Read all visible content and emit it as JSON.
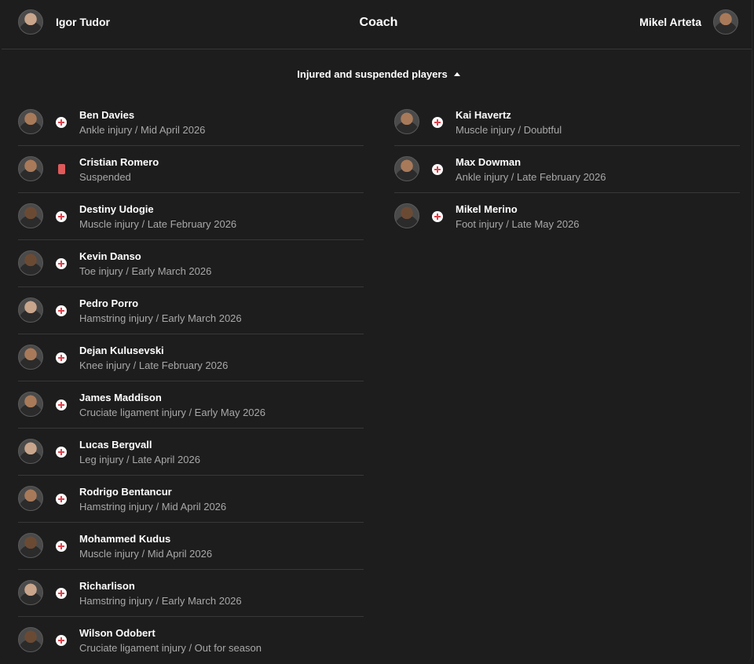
{
  "header": {
    "home_coach": "Igor Tudor",
    "title": "Coach",
    "away_coach": "Mikel Arteta"
  },
  "section": {
    "label": "Injured and suspended players",
    "expanded": true
  },
  "colors": {
    "background": "#1d1d1d",
    "divider": "#383838",
    "injury_cross": "#e0424b",
    "red_card": "#e05a5a",
    "muted_text": "#a8a8a8"
  },
  "home_players": [
    {
      "name": "Ben Davies",
      "detail": "Ankle injury / Mid April 2026",
      "status": "injury"
    },
    {
      "name": "Cristian Romero",
      "detail": "Suspended",
      "status": "red-card"
    },
    {
      "name": "Destiny Udogie",
      "detail": "Muscle injury / Late February 2026",
      "status": "injury"
    },
    {
      "name": "Kevin Danso",
      "detail": "Toe injury / Early March 2026",
      "status": "injury"
    },
    {
      "name": "Pedro Porro",
      "detail": "Hamstring injury / Early March 2026",
      "status": "injury"
    },
    {
      "name": "Dejan Kulusevski",
      "detail": "Knee injury / Late February 2026",
      "status": "injury"
    },
    {
      "name": "James Maddison",
      "detail": "Cruciate ligament injury / Early May 2026",
      "status": "injury"
    },
    {
      "name": "Lucas Bergvall",
      "detail": "Leg injury / Late April 2026",
      "status": "injury"
    },
    {
      "name": "Rodrigo Bentancur",
      "detail": "Hamstring injury / Mid April 2026",
      "status": "injury"
    },
    {
      "name": "Mohammed Kudus",
      "detail": "Muscle injury / Mid April 2026",
      "status": "injury"
    },
    {
      "name": "Richarlison",
      "detail": "Hamstring injury / Early March 2026",
      "status": "injury"
    },
    {
      "name": "Wilson Odobert",
      "detail": "Cruciate ligament injury / Out for season",
      "status": "injury"
    }
  ],
  "away_players": [
    {
      "name": "Kai Havertz",
      "detail": "Muscle injury / Doubtful",
      "status": "injury"
    },
    {
      "name": "Max Dowman",
      "detail": "Ankle injury / Late February 2026",
      "status": "injury"
    },
    {
      "name": "Mikel Merino",
      "detail": "Foot injury / Late May 2026",
      "status": "injury"
    }
  ]
}
